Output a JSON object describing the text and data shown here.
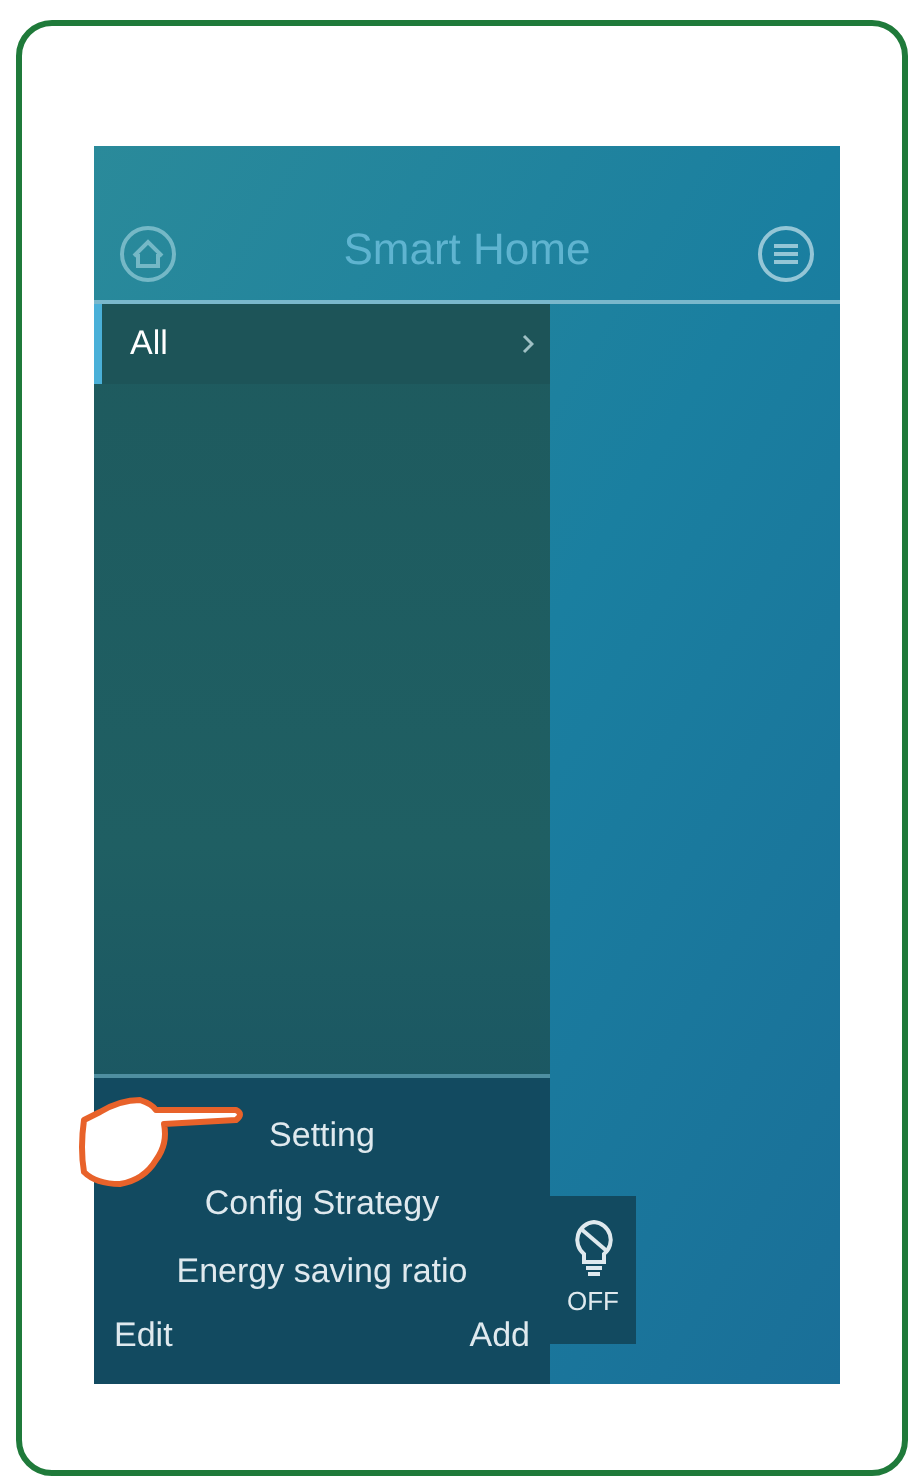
{
  "header": {
    "title": "Smart Home"
  },
  "drawer": {
    "items": [
      {
        "label": "All",
        "selected": true
      }
    ],
    "menu": [
      "Setting",
      "Config Strategy",
      "Energy saving ratio"
    ],
    "actions": [
      "Edit",
      "Add"
    ]
  },
  "device": {
    "label": "OFF",
    "on": false
  }
}
